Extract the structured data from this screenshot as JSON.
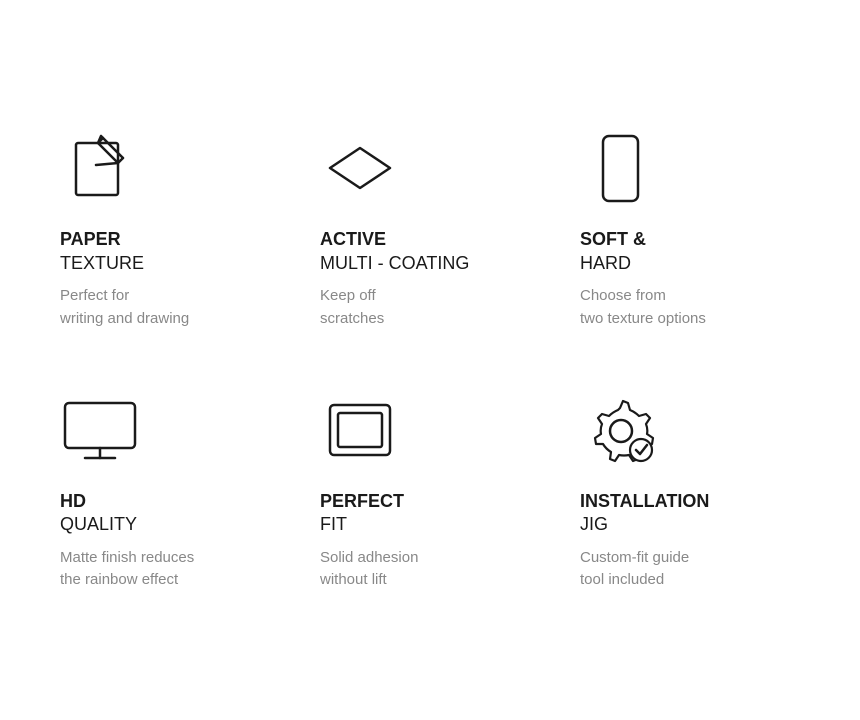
{
  "features": [
    {
      "id": "paper-texture",
      "title_bold": "PAPER",
      "title_normal": "TEXTURE",
      "description_line1": "Perfect for",
      "description_line2": "writing and drawing",
      "icon": "paper-pencil"
    },
    {
      "id": "active-multi-coating",
      "title_bold": "ACTIVE",
      "title_normal": "MULTI - COATING",
      "description_line1": "Keep off",
      "description_line2": "scratches",
      "icon": "diamond"
    },
    {
      "id": "soft-hard",
      "title_bold": "SOFT &",
      "title_normal": "HARD",
      "description_line1": "Choose from",
      "description_line2": "two texture options",
      "icon": "phone"
    },
    {
      "id": "hd-quality",
      "title_bold": "HD",
      "title_normal": "QUALITY",
      "description_line1": "Matte finish reduces",
      "description_line2": "the rainbow effect",
      "icon": "screen"
    },
    {
      "id": "perfect-fit",
      "title_bold": "PERFECT",
      "title_normal": "FIT",
      "description_line1": "Solid adhesion",
      "description_line2": "without lift",
      "icon": "fit"
    },
    {
      "id": "installation-jig",
      "title_bold": "INSTALLATION",
      "title_normal": "JIG",
      "description_line1": "Custom-fit guide",
      "description_line2": "tool included",
      "icon": "gear-check"
    }
  ]
}
